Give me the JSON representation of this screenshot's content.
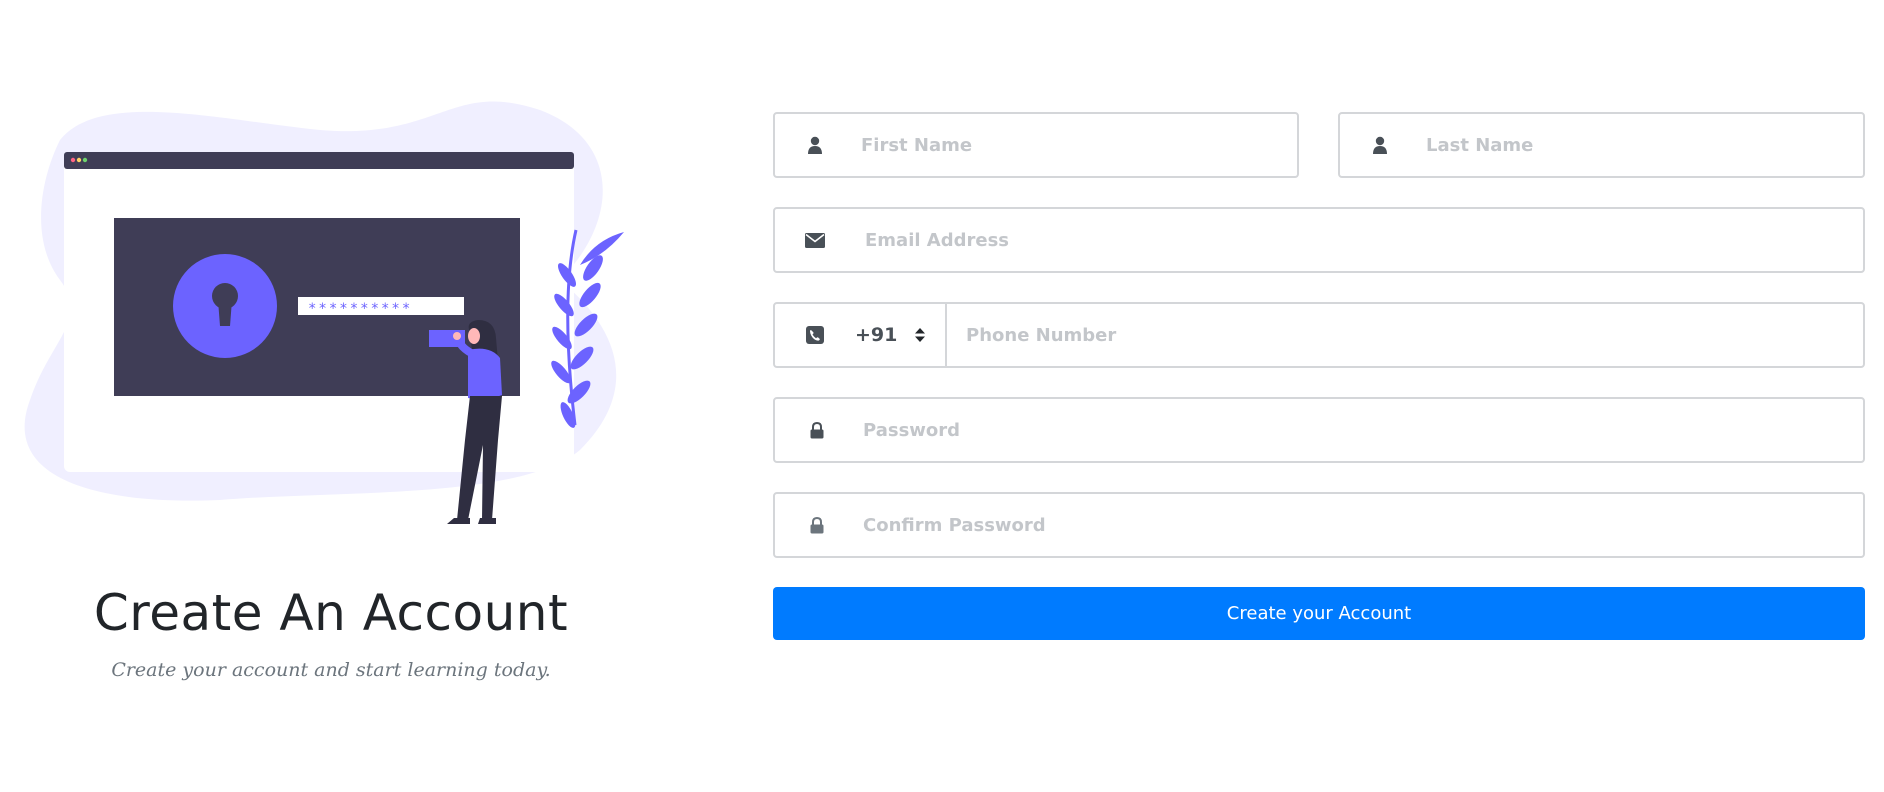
{
  "heading": {
    "title": "Create An Account",
    "subtitle": "Create your account and start learning today."
  },
  "illustration": {
    "icon": "secure-login-illustration",
    "password_mask": "**********",
    "accent_color": "#6c63ff",
    "dark_color": "#3f3d56",
    "blob_color": "#f0efff"
  },
  "form": {
    "first_name": {
      "placeholder": "First Name",
      "value": "",
      "icon": "user-icon"
    },
    "last_name": {
      "placeholder": "Last Name",
      "value": "",
      "icon": "user-icon"
    },
    "email": {
      "placeholder": "Email Address",
      "value": "",
      "icon": "envelope-icon"
    },
    "phone": {
      "placeholder": "Phone Number",
      "value": "",
      "icon": "phone-icon",
      "country_code": "+91"
    },
    "password": {
      "placeholder": "Password",
      "value": "",
      "icon": "lock-icon"
    },
    "confirm_password": {
      "placeholder": "Confirm Password",
      "value": "",
      "icon": "lock-icon"
    },
    "submit_label": "Create your Account"
  },
  "colors": {
    "primary": "#007bff",
    "border": "#d4d6d9",
    "placeholder": "#c3c6ca",
    "icon": "#495057"
  }
}
